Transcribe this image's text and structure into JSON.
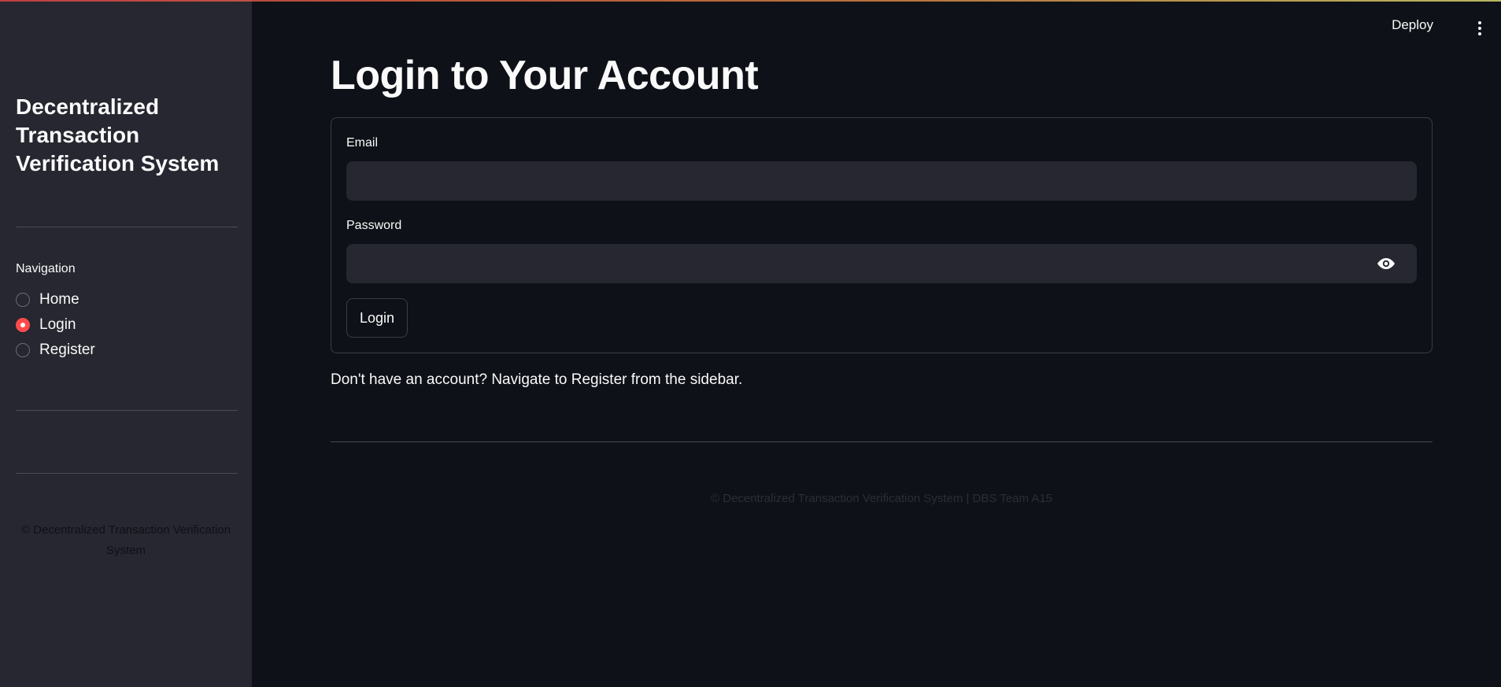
{
  "sidebar": {
    "title": "Decentralized Transaction Verification System",
    "nav_label": "Navigation",
    "items": [
      {
        "label": "Home",
        "selected": false
      },
      {
        "label": "Login",
        "selected": true
      },
      {
        "label": "Register",
        "selected": false
      }
    ],
    "footer": "© Decentralized Transaction Verification System"
  },
  "header": {
    "deploy_label": "Deploy",
    "menu_icon": "kebab-menu-icon"
  },
  "main": {
    "title": "Login to Your Account",
    "form": {
      "email_label": "Email",
      "email_value": "",
      "password_label": "Password",
      "password_value": "",
      "password_toggle_icon": "eye-icon",
      "submit_label": "Login"
    },
    "info_text": "Don't have an account? Navigate to Register from the sidebar.",
    "footer": "© Decentralized Transaction Verification System | DBS Team A15"
  },
  "colors": {
    "accent": "#ff4b4b",
    "background": "#0e1117",
    "sidebar_background": "#262730",
    "input_background": "#262730",
    "text": "#fafafa"
  }
}
